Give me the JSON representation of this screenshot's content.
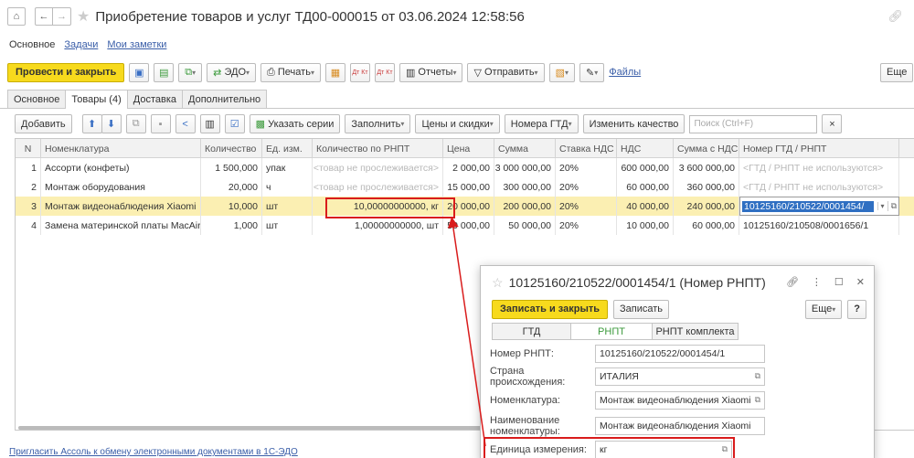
{
  "window": {
    "title": "Приобретение товаров и услуг ТД00-000015 от 03.06.2024 12:58:56"
  },
  "subtabs": [
    "Основное",
    "Задачи",
    "Мои заметки"
  ],
  "toolbar": {
    "post_close": "Провести и закрыть",
    "edo": "ЭДО",
    "print": "Печать",
    "dt_kt_1": "Дт Кт",
    "dt_kt_2": "Дт Кт",
    "reports": "Отчеты",
    "send": "Отправить",
    "files": "Файлы",
    "more": "Еще"
  },
  "doc_tabs": [
    "Основное",
    "Товары (4)",
    "Доставка",
    "Дополнительно"
  ],
  "table_toolbar": {
    "add": "Добавить",
    "specify_series": "Указать серии",
    "fill": "Заполнить",
    "prices": "Цены и скидки",
    "gtd_numbers": "Номера ГТД",
    "change_quality": "Изменить качество",
    "search_placeholder": "Поиск (Ctrl+F)",
    "clear": "×"
  },
  "table": {
    "columns": [
      "N",
      "Номенклатура",
      "Количество",
      "Ед. изм.",
      "Количество по РНПТ",
      "Цена",
      "Сумма",
      "Ставка НДС",
      "НДС",
      "Сумма с НДС",
      "Номер ГТД / РНПТ"
    ],
    "rows": [
      [
        "1",
        "Ассорти (конфеты)",
        "1 500,000",
        "упак",
        "<товар не прослеживается>",
        "2 000,00",
        "3 000 000,00",
        "20%",
        "600 000,00",
        "3 600 000,00",
        "<ГТД / РНПТ не используются>"
      ],
      [
        "2",
        "Монтаж оборудования",
        "20,000",
        "ч",
        "<товар не прослеживается>",
        "15 000,00",
        "300 000,00",
        "20%",
        "60 000,00",
        "360 000,00",
        "<ГТД / РНПТ не используются>"
      ],
      [
        "3",
        "Монтаж видеонаблюдения Xiaomi",
        "10,000",
        "шт",
        "10,00000000000, кг",
        "20 000,00",
        "200 000,00",
        "20%",
        "40 000,00",
        "240 000,00",
        "10125160/210522/0001454/"
      ],
      [
        "4",
        "Замена материнской платы MacAir",
        "1,000",
        "шт",
        "1,00000000000, шт",
        "50 000,00",
        "50 000,00",
        "20%",
        "10 000,00",
        "60 000,00",
        "10125160/210508/0001656/1"
      ]
    ]
  },
  "status": {
    "invite": "Пригласить Ассоль к обмену электронными документами в 1С-ЭДО"
  },
  "dialog": {
    "title": "10125160/210522/0001454/1 (Номер РНПТ)",
    "save_close": "Записать и закрыть",
    "save": "Записать",
    "more": "Еще",
    "help": "?",
    "tabs": [
      "ГТД",
      "РНПТ",
      "РНПТ комплекта"
    ],
    "fields": {
      "rnpt_label": "Номер РНПТ:",
      "rnpt_value": "10125160/210522/0001454/1",
      "country_label": "Страна происхождения:",
      "country_value": "ИТАЛИЯ",
      "nomen_label": "Номенклатура:",
      "nomen_value": "Монтаж видеонаблюдения Xiaomi",
      "nomen_name_label": "Наименование номенклатуры:",
      "nomen_name_value": "Монтаж видеонаблюдения Xiaomi",
      "unit_label": "Единица измерения:",
      "unit_value": "кг"
    }
  },
  "colors": {
    "primary_button": "#f7da1d",
    "selected_row": "#fbefb2",
    "highlight_box": "#d91c1c",
    "link": "#3a5ea8",
    "active_tab_text": "#3c9a3c"
  }
}
